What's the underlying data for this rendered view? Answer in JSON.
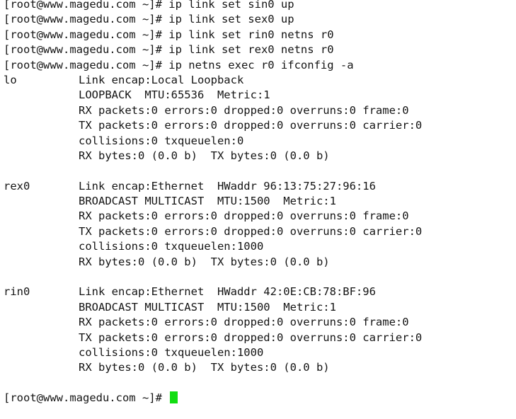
{
  "terminal": {
    "prompt": "[root@www.magedu.com ~]# ",
    "cursor_color": "#11dd11",
    "commands": [
      "ip link set sin0 up",
      "ip link set sex0 up",
      "ip link set rin0 netns r0",
      "ip link set rex0 netns r0",
      "ip netns exec r0 ifconfig -a"
    ],
    "interfaces": [
      {
        "name": "lo",
        "lines": [
          "Link encap:Local Loopback",
          "LOOPBACK  MTU:65536  Metric:1",
          "RX packets:0 errors:0 dropped:0 overruns:0 frame:0",
          "TX packets:0 errors:0 dropped:0 overruns:0 carrier:0",
          "collisions:0 txqueuelen:0",
          "RX bytes:0 (0.0 b)  TX bytes:0 (0.0 b)"
        ]
      },
      {
        "name": "rex0",
        "lines": [
          "Link encap:Ethernet  HWaddr 96:13:75:27:96:16",
          "BROADCAST MULTICAST  MTU:1500  Metric:1",
          "RX packets:0 errors:0 dropped:0 overruns:0 frame:0",
          "TX packets:0 errors:0 dropped:0 overruns:0 carrier:0",
          "collisions:0 txqueuelen:1000",
          "RX bytes:0 (0.0 b)  TX bytes:0 (0.0 b)"
        ]
      },
      {
        "name": "rin0",
        "lines": [
          "Link encap:Ethernet  HWaddr 42:0E:CB:78:BF:96",
          "BROADCAST MULTICAST  MTU:1500  Metric:1",
          "RX packets:0 errors:0 dropped:0 overruns:0 frame:0",
          "TX packets:0 errors:0 dropped:0 overruns:0 carrier:0",
          "collisions:0 txqueuelen:1000",
          "RX bytes:0 (0.0 b)  TX bytes:0 (0.0 b)"
        ]
      }
    ]
  }
}
